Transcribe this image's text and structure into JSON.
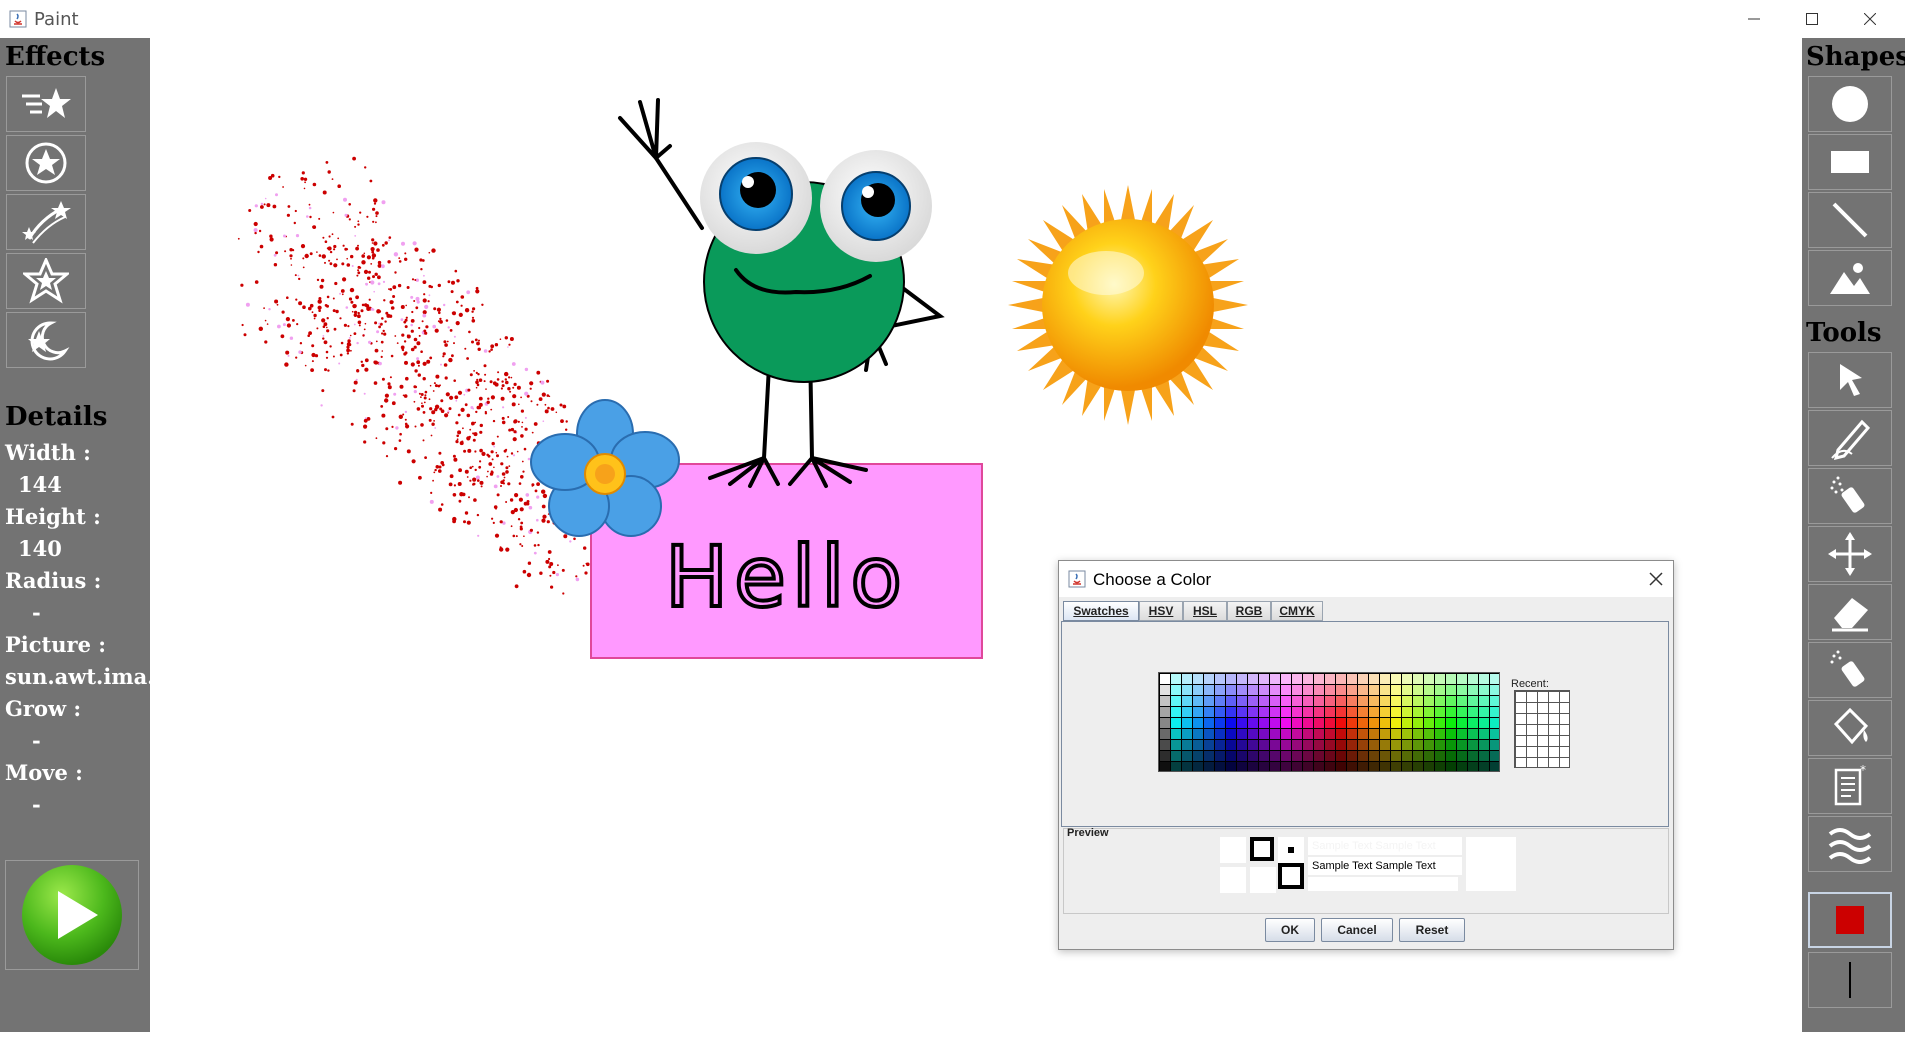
{
  "window": {
    "title": "Paint",
    "minimize_icon": "minimize-icon",
    "maximize_icon": "maximize-icon",
    "close_icon": "close-icon"
  },
  "left_panel": {
    "effects_heading": "Effects",
    "effects": [
      "shooting-star-icon",
      "star-icon",
      "meteor-icon",
      "star-badge-icon",
      "moon-star-icon"
    ],
    "details_heading": "Details",
    "details": [
      {
        "label": "Width :",
        "value": "144"
      },
      {
        "label": "Height :",
        "value": "140"
      },
      {
        "label": "Radius :",
        "value": "-"
      },
      {
        "label": "Picture :",
        "value": "sun.awt.ima..."
      },
      {
        "label": "Grow :",
        "value": "-"
      },
      {
        "label": "Move :",
        "value": "-"
      }
    ],
    "play_icon": "play-icon"
  },
  "right_panel": {
    "shapes_heading": "Shapes",
    "shapes": [
      "circle-icon",
      "rectangle-icon",
      "line-icon",
      "image-icon"
    ],
    "tools_heading": "Tools",
    "tools": [
      "pointer-icon",
      "pencil-icon",
      "spray-icon",
      "move-icon",
      "eraser-icon",
      "spray-eraser-icon",
      "fill-bucket-icon",
      "text-icon",
      "wave-icon",
      "color-swatch-icon",
      "stroke-size-icon"
    ],
    "current_color": "#cc0000"
  },
  "canvas": {
    "sign_text": "Hello",
    "sign_color": "#ff99ff",
    "monster_color": "#0a9a5a",
    "spray_color": "#cc0000"
  },
  "color_dialog": {
    "title": "Choose a Color",
    "tabs": [
      "Swatches",
      "HSV",
      "HSL",
      "RGB",
      "CMYK"
    ],
    "recent_label": "Recent:",
    "preview_label": "Preview",
    "sample_text": "Sample Text",
    "buttons": {
      "ok": "OK",
      "cancel": "Cancel",
      "reset": "Reset"
    }
  }
}
